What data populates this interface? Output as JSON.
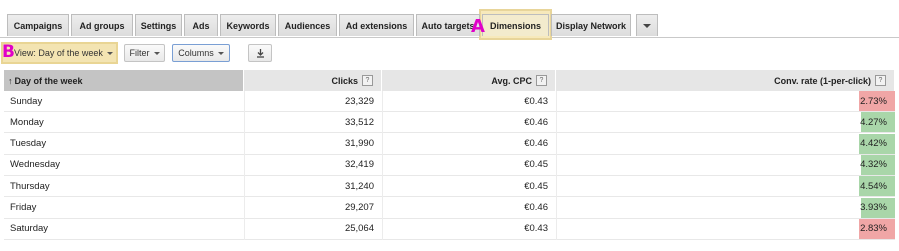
{
  "tabs": [
    {
      "label": "Campaigns"
    },
    {
      "label": "Ad groups"
    },
    {
      "label": "Settings"
    },
    {
      "label": "Ads"
    },
    {
      "label": "Keywords"
    },
    {
      "label": "Audiences"
    },
    {
      "label": "Ad extensions"
    },
    {
      "label": "Auto targets"
    },
    {
      "label": "Dimensions"
    },
    {
      "label": "Display Network"
    }
  ],
  "more_tabs_icon": "chevron-down-icon",
  "callouts": {
    "a": "A",
    "b": "B"
  },
  "toolbar": {
    "view_label": "View: Day of the week",
    "filter_label": "Filter",
    "columns_label": "Columns",
    "download_icon": "download-icon"
  },
  "table": {
    "headers": {
      "day": "Day of the week",
      "sort_arrow": "↑",
      "clicks": "Clicks",
      "cpc": "Avg. CPC",
      "conv": "Conv. rate (1-per-click)",
      "help": "?"
    },
    "rows": [
      {
        "day": "Sunday",
        "clicks": "23,329",
        "cpc": "€0.43",
        "conv": "2.73%",
        "conv_value": 2.73,
        "status": "bad"
      },
      {
        "day": "Monday",
        "clicks": "33,512",
        "cpc": "€0.46",
        "conv": "4.27%",
        "conv_value": 4.27,
        "status": "good"
      },
      {
        "day": "Tuesday",
        "clicks": "31,990",
        "cpc": "€0.46",
        "conv": "4.42%",
        "conv_value": 4.42,
        "status": "good"
      },
      {
        "day": "Wednesday",
        "clicks": "32,419",
        "cpc": "€0.45",
        "conv": "4.32%",
        "conv_value": 4.32,
        "status": "good"
      },
      {
        "day": "Thursday",
        "clicks": "31,240",
        "cpc": "€0.45",
        "conv": "4.54%",
        "conv_value": 4.54,
        "status": "good"
      },
      {
        "day": "Friday",
        "clicks": "29,207",
        "cpc": "€0.46",
        "conv": "3.93%",
        "conv_value": 3.93,
        "status": "good"
      },
      {
        "day": "Saturday",
        "clicks": "25,064",
        "cpc": "€0.43",
        "conv": "2.83%",
        "conv_value": 2.83,
        "status": "bad"
      }
    ]
  },
  "colors": {
    "good": "#a9d6a9",
    "bad": "#f0a6a6",
    "callout": "#e000c8",
    "highlight": "#f3e4b2"
  }
}
